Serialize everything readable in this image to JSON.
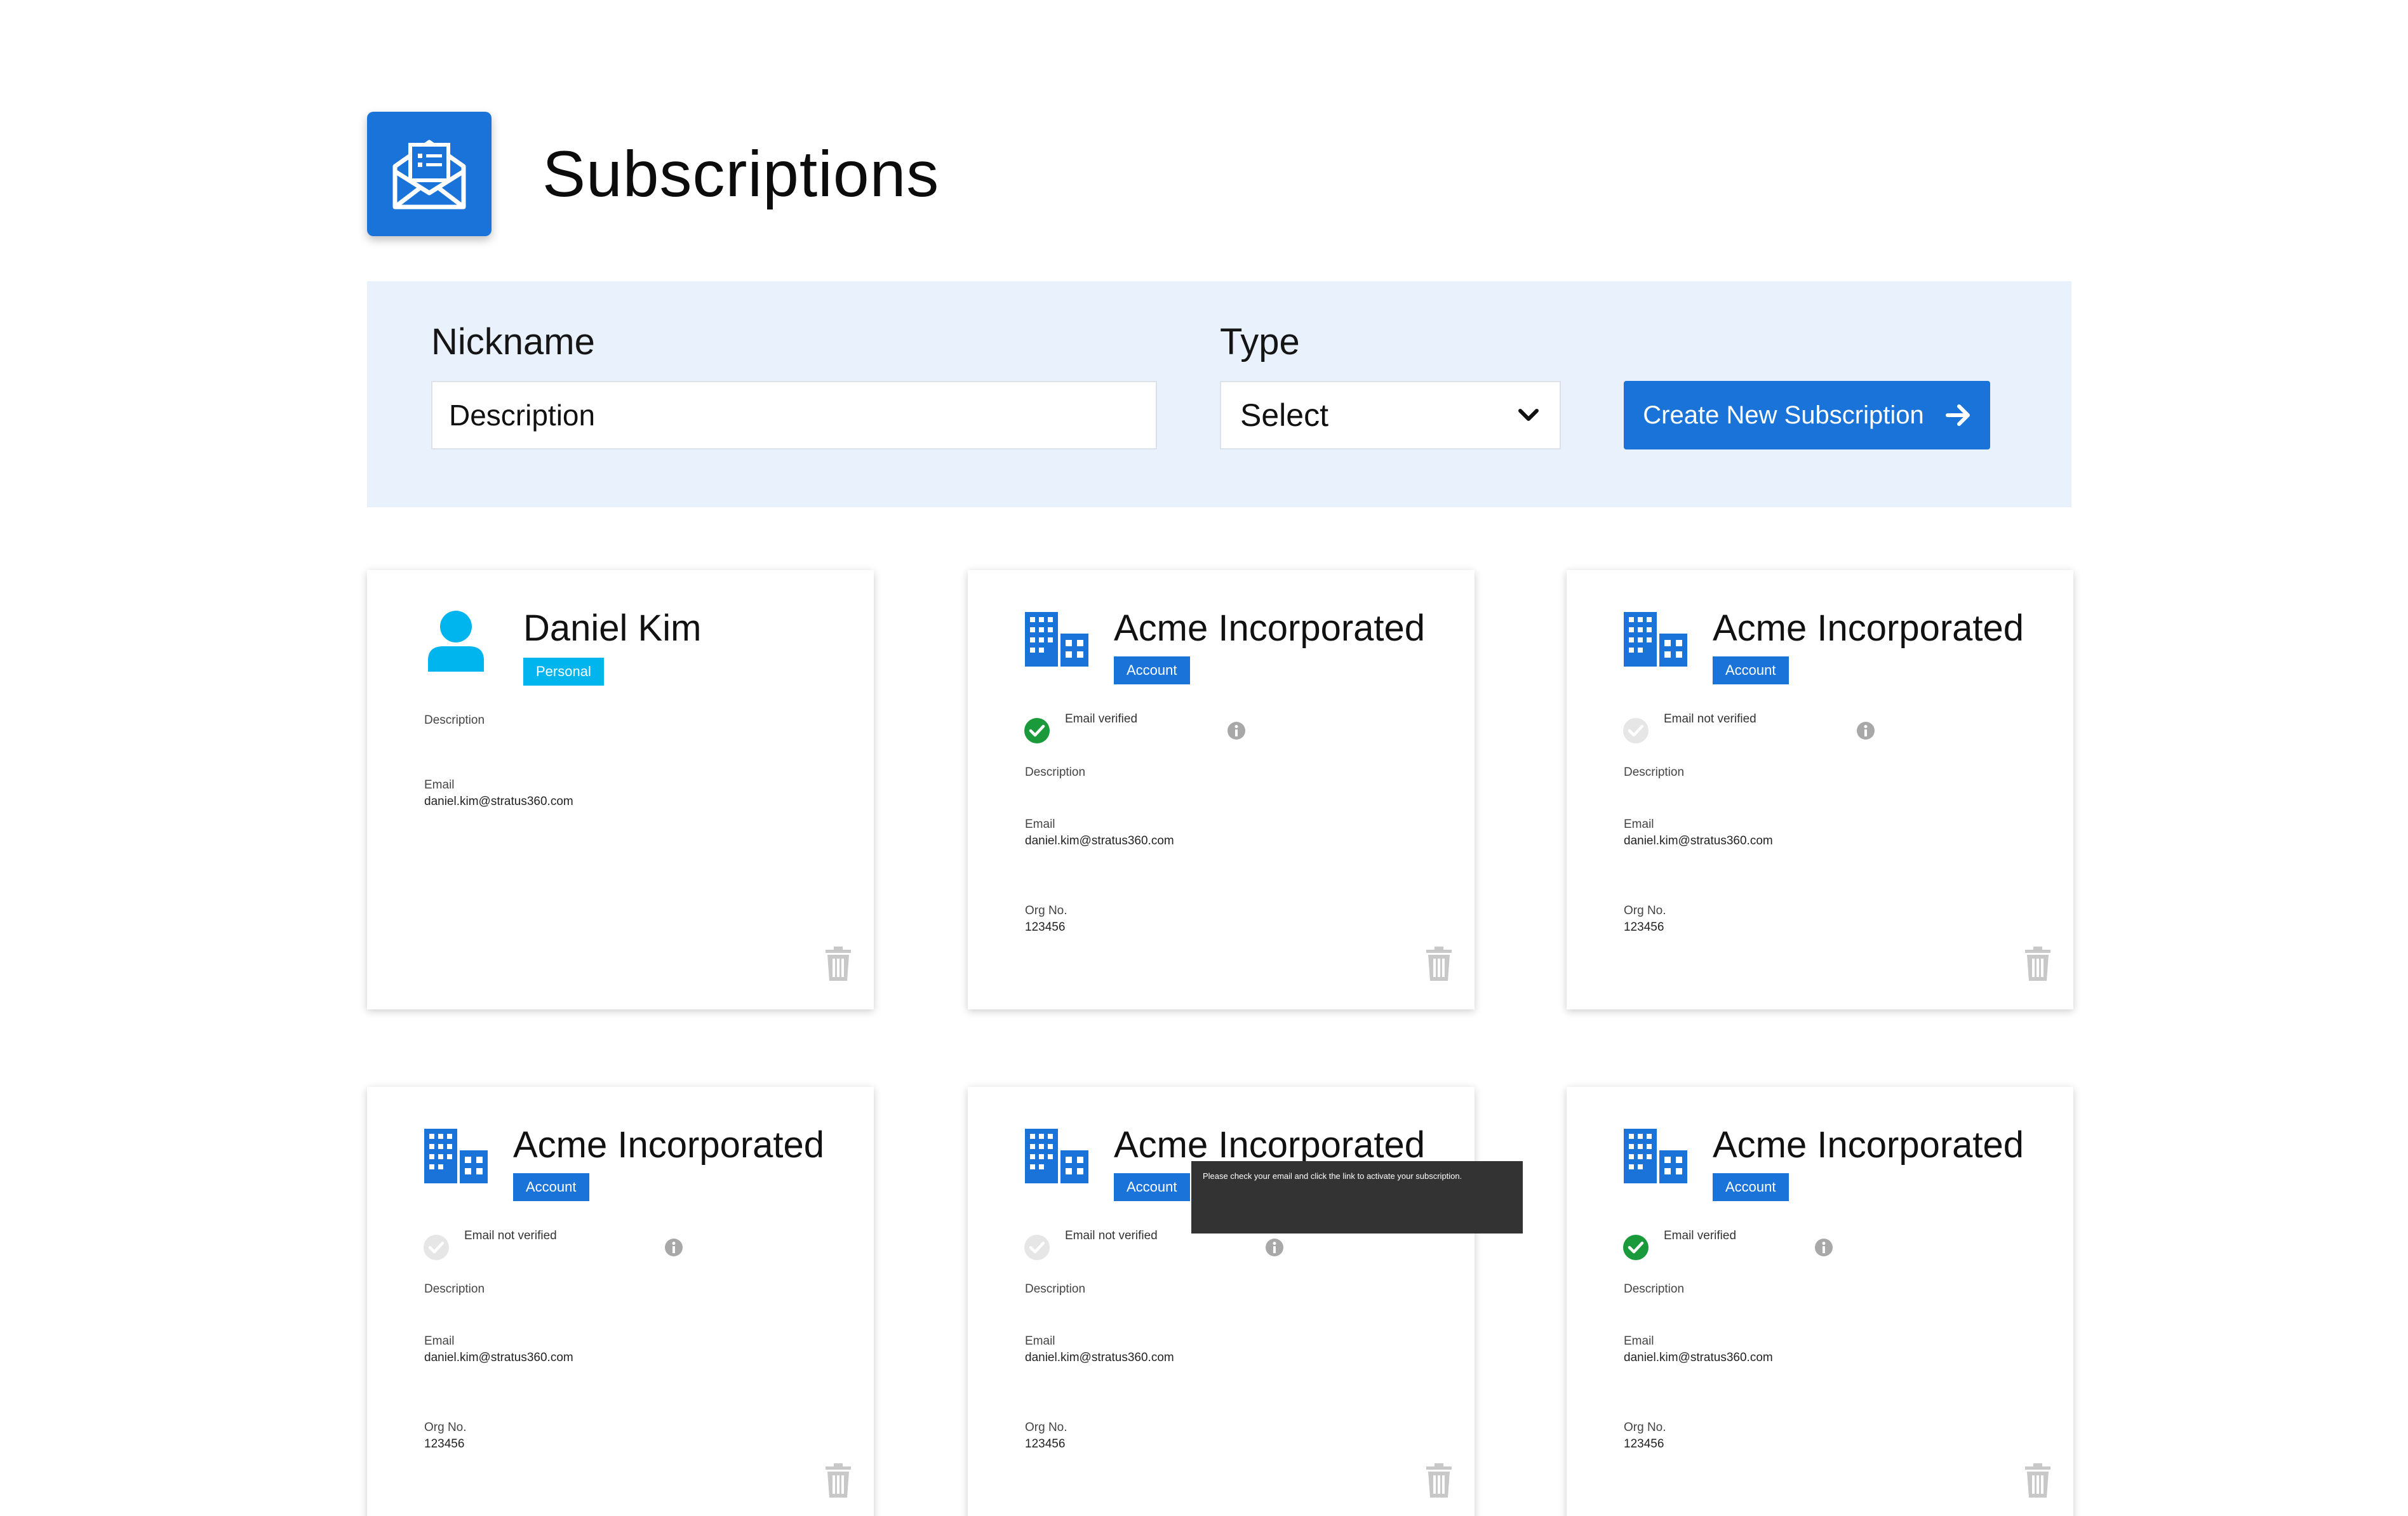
{
  "page": {
    "title": "Subscriptions"
  },
  "filter": {
    "nickname_label": "Nickname",
    "nickname_value": "Description",
    "type_label": "Type",
    "type_value": "Select",
    "create_label": "Create New Subscription"
  },
  "tooltip": {
    "text": "Please check your email and click the link to activate your subscription."
  },
  "cards": [
    {
      "name": "Daniel Kim",
      "kind": "personal",
      "badge": "Personal",
      "verification": "",
      "description": "Description",
      "email_label": "Email",
      "email": "daniel.kim@stratus360.com",
      "org_label": "",
      "org_no": ""
    },
    {
      "name": "Acme Incorporated",
      "kind": "account",
      "badge": "Account",
      "verification": "Email verified",
      "verified": true,
      "description": "Description",
      "email_label": "Email",
      "email": "daniel.kim@stratus360.com",
      "org_label": "Org No.",
      "org_no": "123456"
    },
    {
      "name": "Acme Incorporated",
      "kind": "account",
      "badge": "Account",
      "verification": "Email not verified",
      "verified": false,
      "description": "Description",
      "email_label": "Email",
      "email": "daniel.kim@stratus360.com",
      "org_label": "Org No.",
      "org_no": "123456"
    },
    {
      "name": "Acme Incorporated",
      "kind": "account",
      "badge": "Account",
      "verification": "Email not verified",
      "verified": false,
      "description": "Description",
      "email_label": "Email",
      "email": "daniel.kim@stratus360.com",
      "org_label": "Org No.",
      "org_no": "123456"
    },
    {
      "name": "Acme Incorporated",
      "kind": "account",
      "badge": "Account",
      "verification": "Email not verified",
      "verified": false,
      "description": "Description",
      "email_label": "Email",
      "email": "daniel.kim@stratus360.com",
      "org_label": "Org No.",
      "org_no": "123456"
    },
    {
      "name": "Acme Incorporated",
      "kind": "account",
      "badge": "Account",
      "verification": "Email verified",
      "verified": true,
      "description": "Description",
      "email_label": "Email",
      "email": "daniel.kim@stratus360.com",
      "org_label": "Org No.",
      "org_no": "123456"
    }
  ],
  "colors": {
    "primary": "#1a73d9",
    "personal": "#00b4ee",
    "verified": "#1a9a3a",
    "unverified": "#e6e6e6",
    "filter_bg": "#e8f1fc",
    "tooltip_bg": "#333333"
  },
  "icons": {
    "app": "envelope-open-icon",
    "personal": "person-icon",
    "account": "building-icon",
    "verified": "check-circle-icon",
    "unverified": "check-circle-outline-icon",
    "info": "info-icon",
    "delete": "trash-icon",
    "select": "chevron-down-icon",
    "create": "arrow-right-icon"
  }
}
